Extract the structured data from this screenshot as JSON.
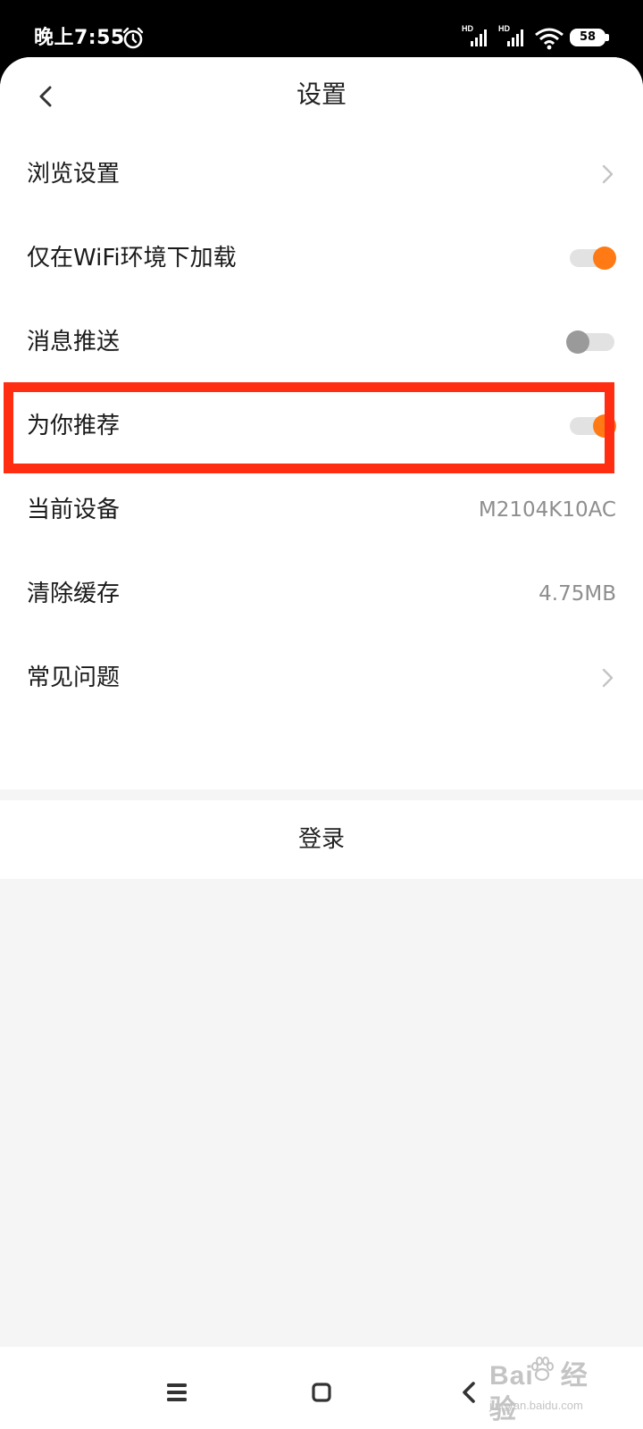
{
  "status_bar": {
    "time": "晚上7:55",
    "signal_label": "HD",
    "battery_level": "58",
    "icons": [
      "alarm-icon",
      "signal-icon",
      "signal-icon",
      "wifi-icon",
      "battery-icon"
    ]
  },
  "header": {
    "title": "设置",
    "back_icon": "chevron-left-icon"
  },
  "settings": {
    "items": [
      {
        "label": "浏览设置",
        "control": "chevron"
      },
      {
        "label": "仅在WiFi环境下加载",
        "control": "toggle",
        "on": true
      },
      {
        "label": "消息推送",
        "control": "toggle",
        "on": false
      },
      {
        "label": "为你推荐",
        "control": "toggle",
        "on": true
      },
      {
        "label": "当前设备",
        "control": "value",
        "value": "M2104K10AC"
      },
      {
        "label": "清除缓存",
        "control": "value",
        "value": "4.75MB"
      },
      {
        "label": "常见问题",
        "control": "chevron"
      }
    ]
  },
  "login": {
    "label": "登录"
  },
  "highlight": {
    "color": "#ff2d12",
    "target": "为你推荐"
  },
  "colors": {
    "accent": "#ff7a14",
    "toggle_off_knob": "#9a9a9a",
    "page_background": "#f5f5f5"
  },
  "nav_bar": {
    "icons": [
      "menu-icon",
      "home-icon",
      "back-icon"
    ]
  },
  "watermark": {
    "main_prefix": "Bai",
    "main_suffix": "经验",
    "sub": "jingyan.baidu.com"
  }
}
